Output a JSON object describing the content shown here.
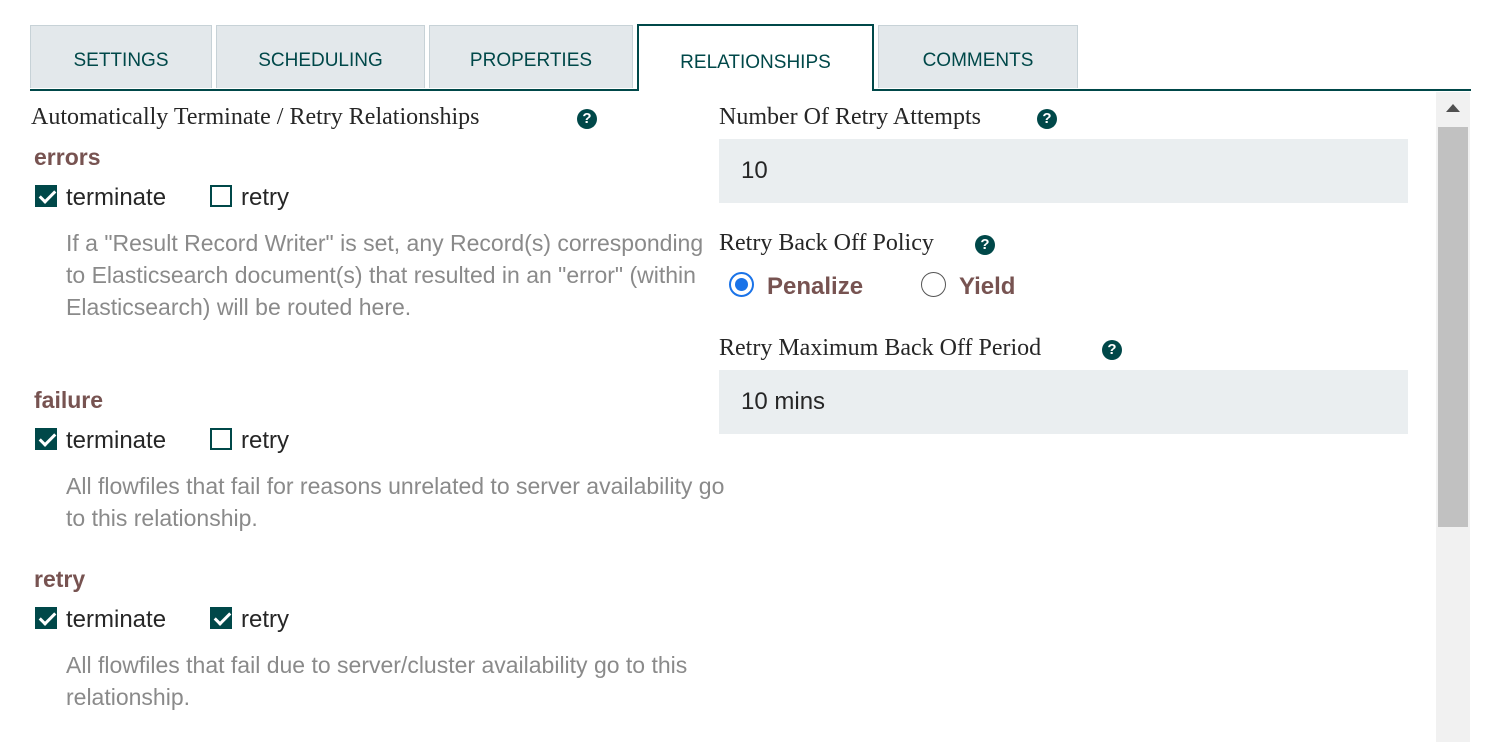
{
  "tabs": [
    {
      "label": "SETTINGS",
      "active": false
    },
    {
      "label": "SCHEDULING",
      "active": false
    },
    {
      "label": "PROPERTIES",
      "active": false
    },
    {
      "label": "RELATIONSHIPS",
      "active": true
    },
    {
      "label": "COMMENTS",
      "active": false
    }
  ],
  "left": {
    "heading": "Automatically Terminate / Retry Relationships",
    "help_icon": "question-circle-icon",
    "relationships": [
      {
        "name": "errors",
        "terminate_label": "terminate",
        "terminate_checked": true,
        "retry_label": "retry",
        "retry_checked": false,
        "description": "If a \"Result Record Writer\" is set, any Record(s) corresponding to Elasticsearch document(s) that resulted in an \"error\" (within Elasticsearch) will be routed here."
      },
      {
        "name": "failure",
        "terminate_label": "terminate",
        "terminate_checked": true,
        "retry_label": "retry",
        "retry_checked": false,
        "description": "All flowfiles that fail for reasons unrelated to server availability go to this relationship."
      },
      {
        "name": "retry",
        "terminate_label": "terminate",
        "terminate_checked": true,
        "retry_label": "retry",
        "retry_checked": true,
        "description": "All flowfiles that fail due to server/cluster availability go to this relationship."
      }
    ]
  },
  "right": {
    "retry_attempts": {
      "label": "Number Of Retry Attempts",
      "value": "10"
    },
    "backoff_policy": {
      "label": "Retry Back Off Policy",
      "options": [
        "Penalize",
        "Yield"
      ],
      "selected": "Penalize"
    },
    "max_backoff": {
      "label": "Retry Maximum Back Off Period",
      "value": "10 mins"
    }
  },
  "colors": {
    "accent": "#004849",
    "relationship_name": "#775351",
    "radio_selected": "#1a73e8",
    "field_bg": "#eaeef0",
    "description": "#8a8a8a"
  }
}
